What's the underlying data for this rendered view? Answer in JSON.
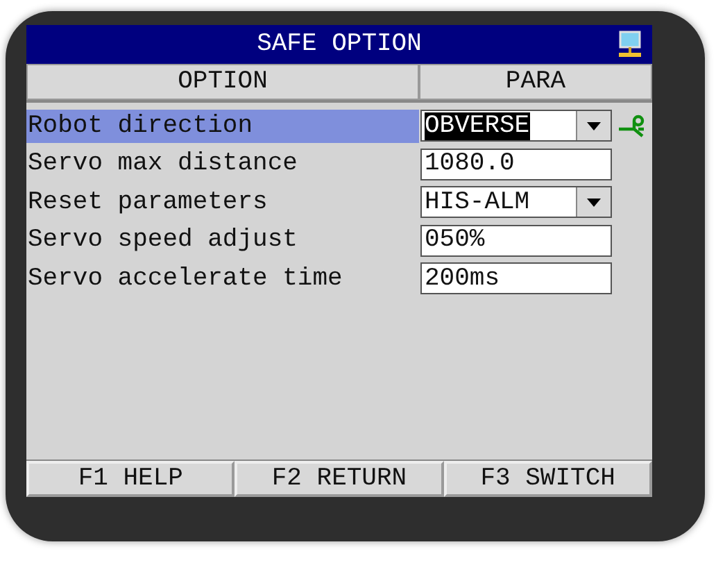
{
  "window": {
    "title": "SAFE OPTION"
  },
  "table": {
    "columns": [
      "OPTION",
      "PARA"
    ],
    "rows": [
      {
        "label": "Robot direction",
        "kind": "dropdown",
        "value": "OBVERSE",
        "selected": true
      },
      {
        "label": "Servo max distance",
        "kind": "text",
        "value": "1080.0",
        "selected": false
      },
      {
        "label": "Reset parameters",
        "kind": "dropdown",
        "value": "HIS-ALM",
        "selected": false
      },
      {
        "label": "Servo speed adjust",
        "kind": "text",
        "value": "050%",
        "selected": false
      },
      {
        "label": "Servo accelerate time",
        "kind": "text",
        "value": "200ms",
        "selected": false
      }
    ]
  },
  "function_keys": [
    "F1 HELP",
    "F2 RETURN",
    "F3 SWITCH"
  ]
}
